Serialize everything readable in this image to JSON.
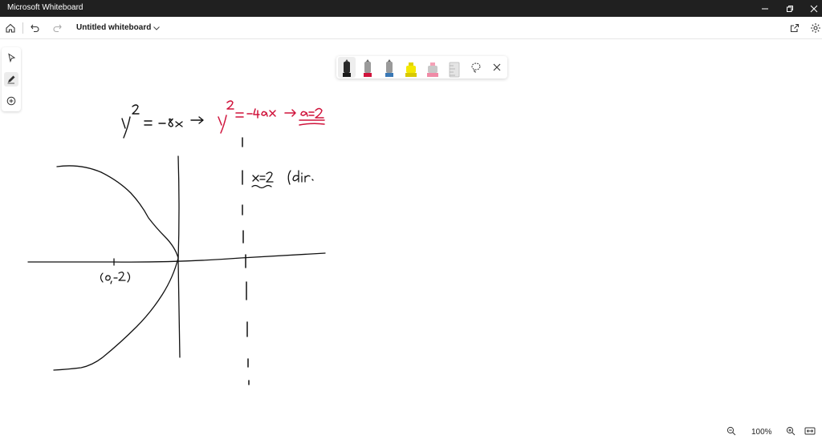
{
  "window": {
    "app_title": "Microsoft Whiteboard",
    "controls": [
      "minimize-icon",
      "restore-icon",
      "close-icon"
    ]
  },
  "toolbar": {
    "board_title": "Untitled whiteboard",
    "left_icons": [
      "home-icon",
      "undo-icon",
      "redo-icon"
    ],
    "right_icons": [
      "share-icon",
      "settings-icon"
    ]
  },
  "left_tools": [
    "select-pointer-icon",
    "inking-pen-icon",
    "add-content-icon"
  ],
  "ink_tools": {
    "pens": [
      {
        "name": "black-pen",
        "color": "#1a1a1a"
      },
      {
        "name": "red-pen",
        "color": "#d0143c"
      },
      {
        "name": "blue-pen",
        "color": "#3a78b5"
      },
      {
        "name": "yellow-highlighter",
        "color": "#f4e800"
      },
      {
        "name": "pink-highlighter",
        "color": "#f08aa6"
      }
    ],
    "extra_icons": [
      "ruler-icon",
      "lasso-select-icon",
      "close-icon"
    ]
  },
  "canvas": {
    "ink_black": "#111111",
    "ink_red": "#d0143c"
  },
  "zoom": {
    "label": "100%"
  }
}
